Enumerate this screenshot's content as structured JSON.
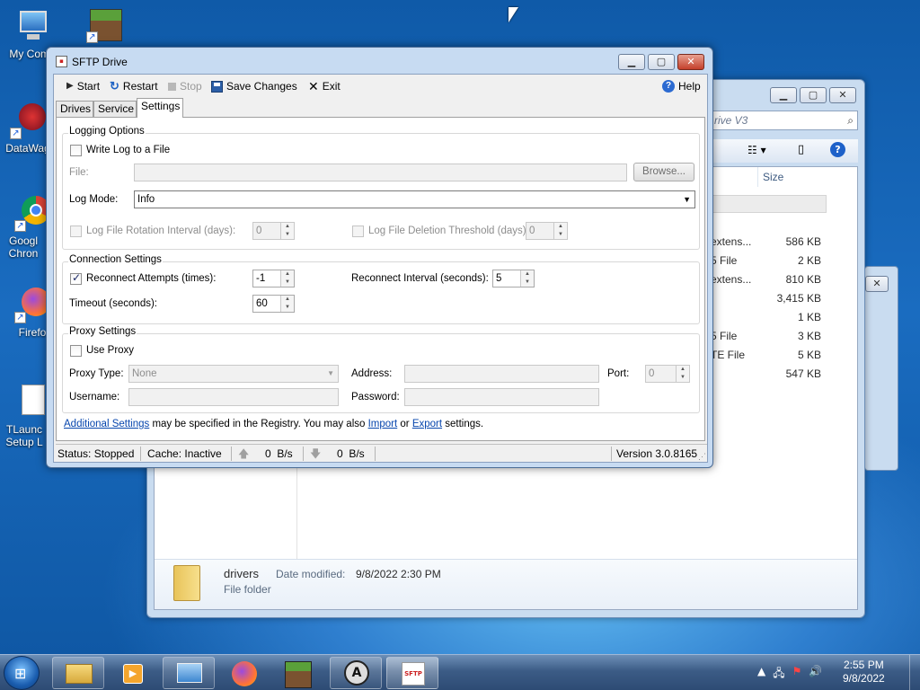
{
  "desktop": {
    "icons": [
      {
        "label": "My Comp"
      },
      {
        "label": "DataWag"
      },
      {
        "label": "Googl Chron"
      },
      {
        "label": "Firefo"
      },
      {
        "label": "TLaunc Setup L"
      }
    ]
  },
  "explorer": {
    "search_placeholder": "rive V3",
    "size_header": "Size",
    "rows": [
      {
        "type": "extens...",
        "size": "586 KB"
      },
      {
        "type": "5 File",
        "size": "2 KB"
      },
      {
        "type": "extens...",
        "size": "810 KB"
      },
      {
        "type": "",
        "size": "3,415 KB"
      },
      {
        "type": "",
        "size": "1 KB"
      },
      {
        "type": "5 File",
        "size": "3 KB"
      },
      {
        "type": "TE File",
        "size": "5 KB"
      },
      {
        "type": "",
        "size": "547 KB"
      }
    ],
    "details": {
      "name": "drivers",
      "modified_label": "Date modified:",
      "modified_value": "9/8/2022 2:30 PM",
      "kind": "File folder"
    }
  },
  "window": {
    "title": "SFTP Drive",
    "toolbar": {
      "start": "Start",
      "restart": "Restart",
      "stop": "Stop",
      "save": "Save Changes",
      "exit": "Exit",
      "help": "Help"
    },
    "tabs": [
      {
        "label": "Drives"
      },
      {
        "label": "Service"
      },
      {
        "label": "Settings"
      }
    ],
    "logging": {
      "group_title": "Logging Options",
      "write_log": "Write Log to a File",
      "file_label": "File:",
      "browse": "Browse...",
      "mode_label": "Log Mode:",
      "mode_value": "Info",
      "rotation_label": "Log File Rotation Interval (days):",
      "rotation_value": "0",
      "deletion_label": "Log File Deletion Threshold (days):",
      "deletion_value": "0"
    },
    "connection": {
      "group_title": "Connection Settings",
      "reconnect_label": "Reconnect Attempts (times):",
      "reconnect_value": "-1",
      "interval_label": "Reconnect Interval (seconds):",
      "interval_value": "5",
      "timeout_label": "Timeout (seconds):",
      "timeout_value": "60"
    },
    "proxy": {
      "group_title": "Proxy Settings",
      "use_proxy": "Use Proxy",
      "type_label": "Proxy Type:",
      "type_value": "None",
      "address_label": "Address:",
      "port_label": "Port:",
      "port_value": "0",
      "username_label": "Username:",
      "password_label": "Password:"
    },
    "footer": {
      "link_additional": "Additional Settings",
      "text1": " may be specified in the Registry. You may also ",
      "link_import": "Import",
      "text2": " or ",
      "link_export": "Export",
      "text3": " settings."
    },
    "status": {
      "status": "Status: Stopped",
      "cache": "Cache: Inactive",
      "up_rate": "0  B/s",
      "down_rate": "0  B/s",
      "version": "Version 3.0.8165"
    }
  },
  "taskbar": {
    "sftp_label": "SFTP",
    "time": "2:55 PM",
    "date": "9/8/2022"
  }
}
